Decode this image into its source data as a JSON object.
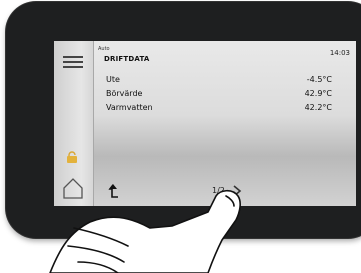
{
  "status": {
    "mode": "Auto",
    "time": "14:03"
  },
  "screen": {
    "title": "DRIFTDATA"
  },
  "rows": [
    {
      "label": "Ute",
      "value": "-4.5°C"
    },
    {
      "label": "Börvärde",
      "value": "42.9°C"
    },
    {
      "label": "Varmvatten",
      "value": "42.2°C"
    }
  ],
  "pager": {
    "text": "1/2"
  },
  "icons": {
    "menu": "hamburger-menu-icon",
    "lock": "padlock-icon",
    "home": "home-icon",
    "back": "back-arrow-icon",
    "next": "chevron-right-icon"
  },
  "colors": {
    "device": "#1e1f20",
    "lock": "#e3b23c"
  }
}
